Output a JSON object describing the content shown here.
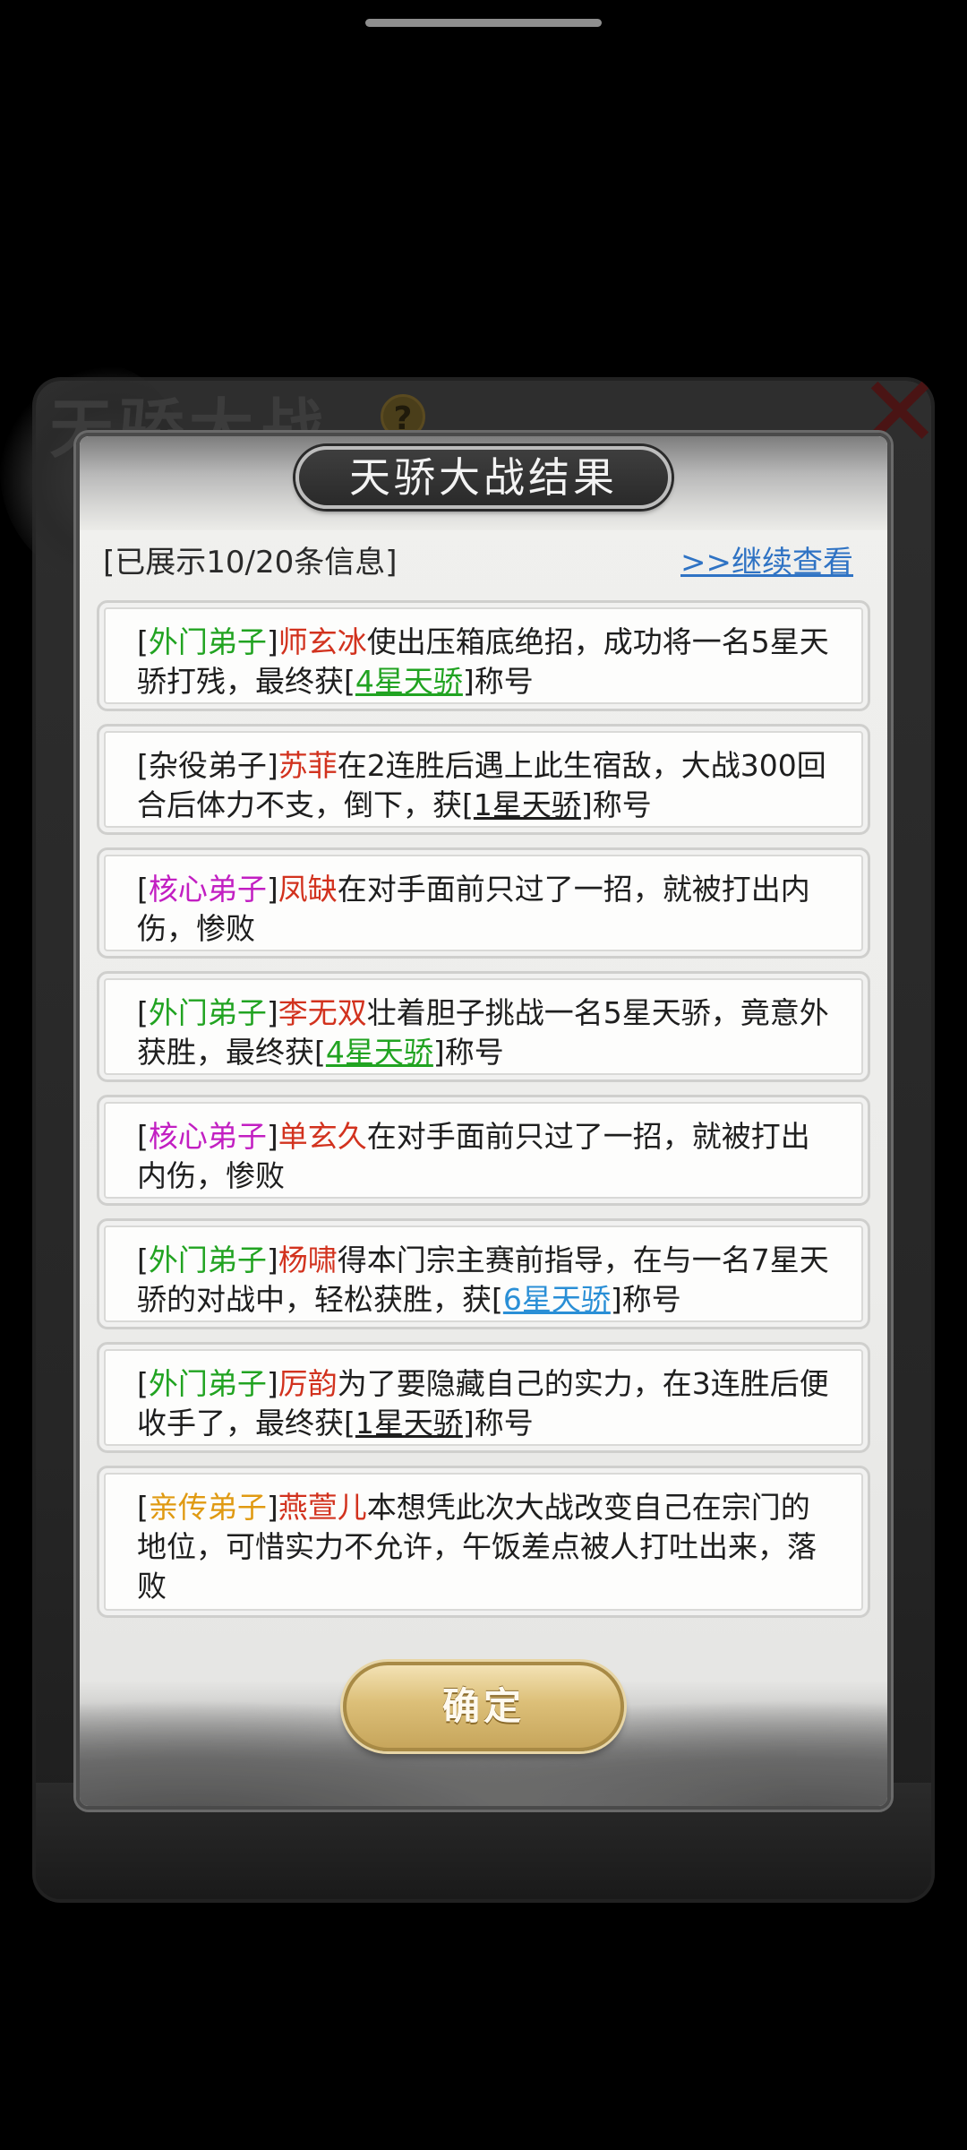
{
  "background": {
    "title": "天骄大战",
    "help_icon": "?",
    "close_icon": "✕"
  },
  "dialog": {
    "title": "天骄大战结果",
    "info_count": "[已展示10/20条信息]",
    "continue_link": ">>继续查看",
    "confirm_label": "确定"
  },
  "entries": [
    {
      "rank": "外门弟子",
      "rank_color": "green",
      "name": "师玄冰",
      "text1": "使出压箱底绝招，成功将一名5星天骄打残，最终获",
      "title": "4星天骄",
      "title_color": "green",
      "suffix": "称号"
    },
    {
      "rank": "杂役弟子",
      "rank_color": "gray",
      "name": "苏菲",
      "text1": "在2连胜后遇上此生宿敌，大战300回合后体力不支，倒下，获",
      "title": "1星天骄",
      "title_color": "black",
      "suffix": "称号"
    },
    {
      "rank": "核心弟子",
      "rank_color": "magenta",
      "name": "凤缺",
      "text1": "在对手面前只过了一招，就被打出内伤，惨败",
      "title": "",
      "title_color": "",
      "suffix": ""
    },
    {
      "rank": "外门弟子",
      "rank_color": "green",
      "name": "李无双",
      "text1": "壮着胆子挑战一名5星天骄，竟意外获胜，最终获",
      "title": "4星天骄",
      "title_color": "green",
      "suffix": "称号"
    },
    {
      "rank": "核心弟子",
      "rank_color": "magenta",
      "name": "单玄久",
      "text1": "在对手面前只过了一招，就被打出内伤，惨败",
      "title": "",
      "title_color": "",
      "suffix": ""
    },
    {
      "rank": "外门弟子",
      "rank_color": "green",
      "name": "杨啸",
      "text1": "得本门宗主赛前指导，在与一名7星天骄的对战中，轻松获胜，获",
      "title": "6星天骄",
      "title_color": "blue",
      "suffix": "称号"
    },
    {
      "rank": "外门弟子",
      "rank_color": "green",
      "name": "厉韵",
      "text1": "为了要隐藏自己的实力，在3连胜后便收手了，最终获",
      "title": "1星天骄",
      "title_color": "black",
      "suffix": "称号"
    },
    {
      "rank": "亲传弟子",
      "rank_color": "orange",
      "name": "燕萱儿",
      "text1": "本想凭此次大战改变自己在宗门的地位，可惜实力不允许，午饭差点被人打吐出来，落败",
      "title": "",
      "title_color": "",
      "suffix": ""
    }
  ],
  "colors": {
    "green": "#21a321",
    "magenta": "#c21fc2",
    "orange": "#e09a12",
    "name_red": "#d2321e",
    "title_blue": "#2a8fd6",
    "link_blue": "#2f73c4"
  }
}
